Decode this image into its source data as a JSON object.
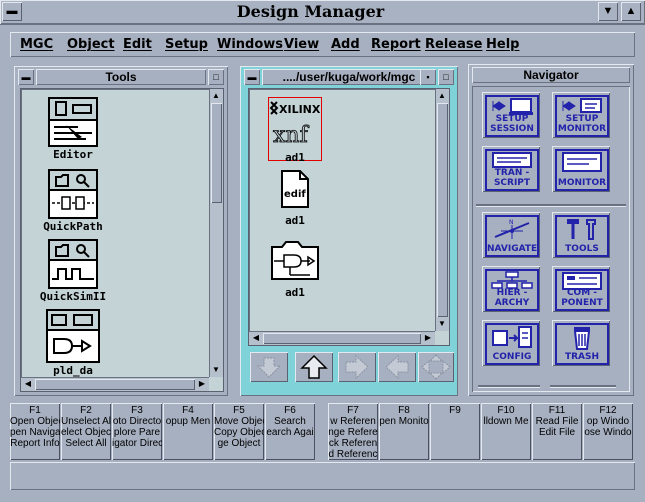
{
  "window": {
    "title": "Design Manager"
  },
  "menu": [
    "MGC",
    "Object",
    "Edit",
    "Setup",
    "Windows",
    "View",
    "Add",
    "Report",
    "Release",
    "Help"
  ],
  "tools_pane": {
    "title": "Tools",
    "items": [
      "Editor",
      "QuickPath",
      "QuickSimII",
      "pld_da"
    ]
  },
  "files_pane": {
    "title": "..../user/kuga/work/mgc",
    "items": [
      {
        "label": "ad1",
        "icon": "xilinx-xnf-icon",
        "logo": "XILINX",
        "ext": "xnf"
      },
      {
        "label": "ad1",
        "icon": "edif-file-icon",
        "ext": "edif"
      },
      {
        "label": "ad1",
        "icon": "schematic-folder-icon"
      }
    ]
  },
  "navigator": {
    "title": "Navigator",
    "buttons": [
      {
        "line1": "SETUP",
        "line2": "SESSION"
      },
      {
        "line1": "SETUP",
        "line2": "MONITOR"
      },
      {
        "line1": "TRAN -",
        "line2": "SCRIPT"
      },
      {
        "line1": "",
        "line2": "MONITOR"
      },
      {
        "line1": "",
        "line2": "NAVIGATE"
      },
      {
        "line1": "",
        "line2": "TOOLS"
      },
      {
        "line1": "HIER -",
        "line2": "ARCHY"
      },
      {
        "line1": "COM -",
        "line2": "PONENT"
      },
      {
        "line1": "",
        "line2": "CONFIG"
      },
      {
        "line1": "",
        "line2": "TRASH"
      }
    ]
  },
  "fkeys": [
    {
      "key": "F1",
      "lines": [
        "Open Objec",
        "pen Naviga",
        "Report Info"
      ]
    },
    {
      "key": "F2",
      "lines": [
        "Unselect Al",
        "elect Objec",
        "Select All"
      ]
    },
    {
      "key": "F3",
      "lines": [
        "oto Directo",
        "plore Pare",
        "igator Direc"
      ]
    },
    {
      "key": "F4",
      "lines": [
        "opup Men"
      ]
    },
    {
      "key": "F5",
      "lines": [
        "Move Objec",
        "Copy Objec",
        "ge Object"
      ]
    },
    {
      "key": "F6",
      "lines": [
        "Search",
        "earch Agai"
      ]
    },
    {
      "key": "F7",
      "lines": [
        "w Referen",
        "nge Refere",
        "ck Referen",
        "d Referenc"
      ]
    },
    {
      "key": "F8",
      "lines": [
        "pen Monito"
      ]
    },
    {
      "key": "F9",
      "lines": []
    },
    {
      "key": "F10",
      "lines": [
        "lldown Me"
      ]
    },
    {
      "key": "F11",
      "lines": [
        "Read File",
        "Edit File"
      ]
    },
    {
      "key": "F12",
      "lines": [
        "op Windo",
        "ose Windo"
      ]
    }
  ],
  "colors": {
    "accent": "#2222aa",
    "well": "#c4d3d6",
    "selection": "#e00000",
    "chrome": "#a7b0c0"
  }
}
